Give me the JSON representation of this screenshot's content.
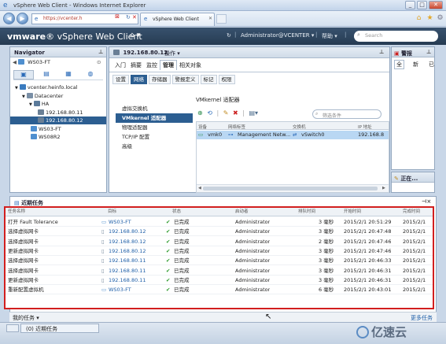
{
  "browser": {
    "title": "vSphere Web Client - Windows Internet Explorer",
    "url": "https://vcenter.h",
    "tab_label": "vSphere Web Client"
  },
  "header": {
    "logo_vmware": "vmware",
    "logo_product": "vSphere Web Client",
    "user": "Administrator@VCENTER",
    "help": "帮助",
    "search_placeholder": "Search"
  },
  "navigator": {
    "title": "Navigator",
    "back_label": "WS03-FT",
    "tree": [
      {
        "label": "vcenter.heinfo.local",
        "indent": 0,
        "icon": "vcenter-icon"
      },
      {
        "label": "Datacenter",
        "indent": 1,
        "icon": "datacenter-icon"
      },
      {
        "label": "HA",
        "indent": 2,
        "icon": "cluster-icon"
      },
      {
        "label": "192.168.80.11",
        "indent": 3,
        "icon": "host-icon"
      },
      {
        "label": "192.168.80.12",
        "indent": 3,
        "icon": "host-icon",
        "selected": true
      },
      {
        "label": "WS03-FT",
        "indent": 2,
        "icon": "vm-icon"
      },
      {
        "label": "WS08R2",
        "indent": 2,
        "icon": "vm-icon"
      }
    ]
  },
  "main": {
    "host": "192.168.80.12",
    "actions": "操作",
    "tabs": [
      "入门",
      "摘要",
      "监控",
      "管理",
      "相关对象"
    ],
    "active_tab": "管理",
    "subtabs": [
      "设置",
      "网络",
      "存储器",
      "警报定义",
      "标记",
      "权限"
    ],
    "active_subtab": "网络",
    "leftnav": [
      "虚拟交换机",
      "VMkernel 适配器",
      "物理适配器",
      "TCP/IP 配置",
      "高级"
    ],
    "active_leftnav": "VMkernel 适配器",
    "section_title": "VMkernel 适配器",
    "filter_placeholder": "筛选条件",
    "grid_headers": [
      "设备",
      "网络标签",
      "交换机",
      "IP 地址"
    ],
    "grid_row": {
      "device": "vmk0",
      "network": "Management Netw...",
      "switch": "vSwitch0",
      "ip": "192.168.8"
    }
  },
  "alarms": {
    "title": "警报",
    "tabs": [
      "全",
      "新",
      "已"
    ],
    "wip_title": "正在..."
  },
  "tasks": {
    "title": "近期任务",
    "headers": [
      "任务名称",
      "目标",
      "状态",
      "启动者",
      "排队时间",
      "开始时间",
      "完成时间"
    ],
    "rows": [
      {
        "name": "打开 Fault Tolerance",
        "target": "WS03-FT",
        "target_type": "vm",
        "status": "已完成",
        "initiator": "Administrator",
        "queue": "3 毫秒",
        "start": "2015/2/1 20:51:29",
        "end": "2015/2/1"
      },
      {
        "name": "选择虚拟网卡",
        "target": "192.168.80.12",
        "target_type": "host",
        "status": "已完成",
        "initiator": "Administrator",
        "queue": "3 毫秒",
        "start": "2015/2/1 20:47:48",
        "end": "2015/2/1"
      },
      {
        "name": "选择虚拟网卡",
        "target": "192.168.80.12",
        "target_type": "host",
        "status": "已完成",
        "initiator": "Administrator",
        "queue": "2 毫秒",
        "start": "2015/2/1 20:47:46",
        "end": "2015/2/1"
      },
      {
        "name": "更新虚拟网卡",
        "target": "192.168.80.12",
        "target_type": "host",
        "status": "已完成",
        "initiator": "Administrator",
        "queue": "3 毫秒",
        "start": "2015/2/1 20:47:46",
        "end": "2015/2/1"
      },
      {
        "name": "选择虚拟网卡",
        "target": "192.168.80.11",
        "target_type": "host",
        "status": "已完成",
        "initiator": "Administrator",
        "queue": "3 毫秒",
        "start": "2015/2/1 20:46:33",
        "end": "2015/2/1"
      },
      {
        "name": "选择虚拟网卡",
        "target": "192.168.80.11",
        "target_type": "host",
        "status": "已完成",
        "initiator": "Administrator",
        "queue": "3 毫秒",
        "start": "2015/2/1 20:46:31",
        "end": "2015/2/1"
      },
      {
        "name": "更新虚拟网卡",
        "target": "192.168.80.11",
        "target_type": "host",
        "status": "已完成",
        "initiator": "Administrator",
        "queue": "3 毫秒",
        "start": "2015/2/1 20:46:31",
        "end": "2015/2/1"
      },
      {
        "name": "重新配置虚拟机",
        "target": "WS03-FT",
        "target_type": "vm",
        "status": "已完成",
        "initiator": "Administrator",
        "queue": "6 毫秒",
        "start": "2015/2/1 20:43:01",
        "end": "2015/2/1"
      }
    ],
    "my_tasks": "我的任务",
    "more_tasks": "更多任务"
  },
  "taskbar": {
    "item_label": "(0) 近期任务",
    "watermark": "亿速云"
  },
  "colors": {
    "accent": "#1f5fa8",
    "selection": "#2c5e91",
    "highlight_border": "#d21f1f"
  }
}
